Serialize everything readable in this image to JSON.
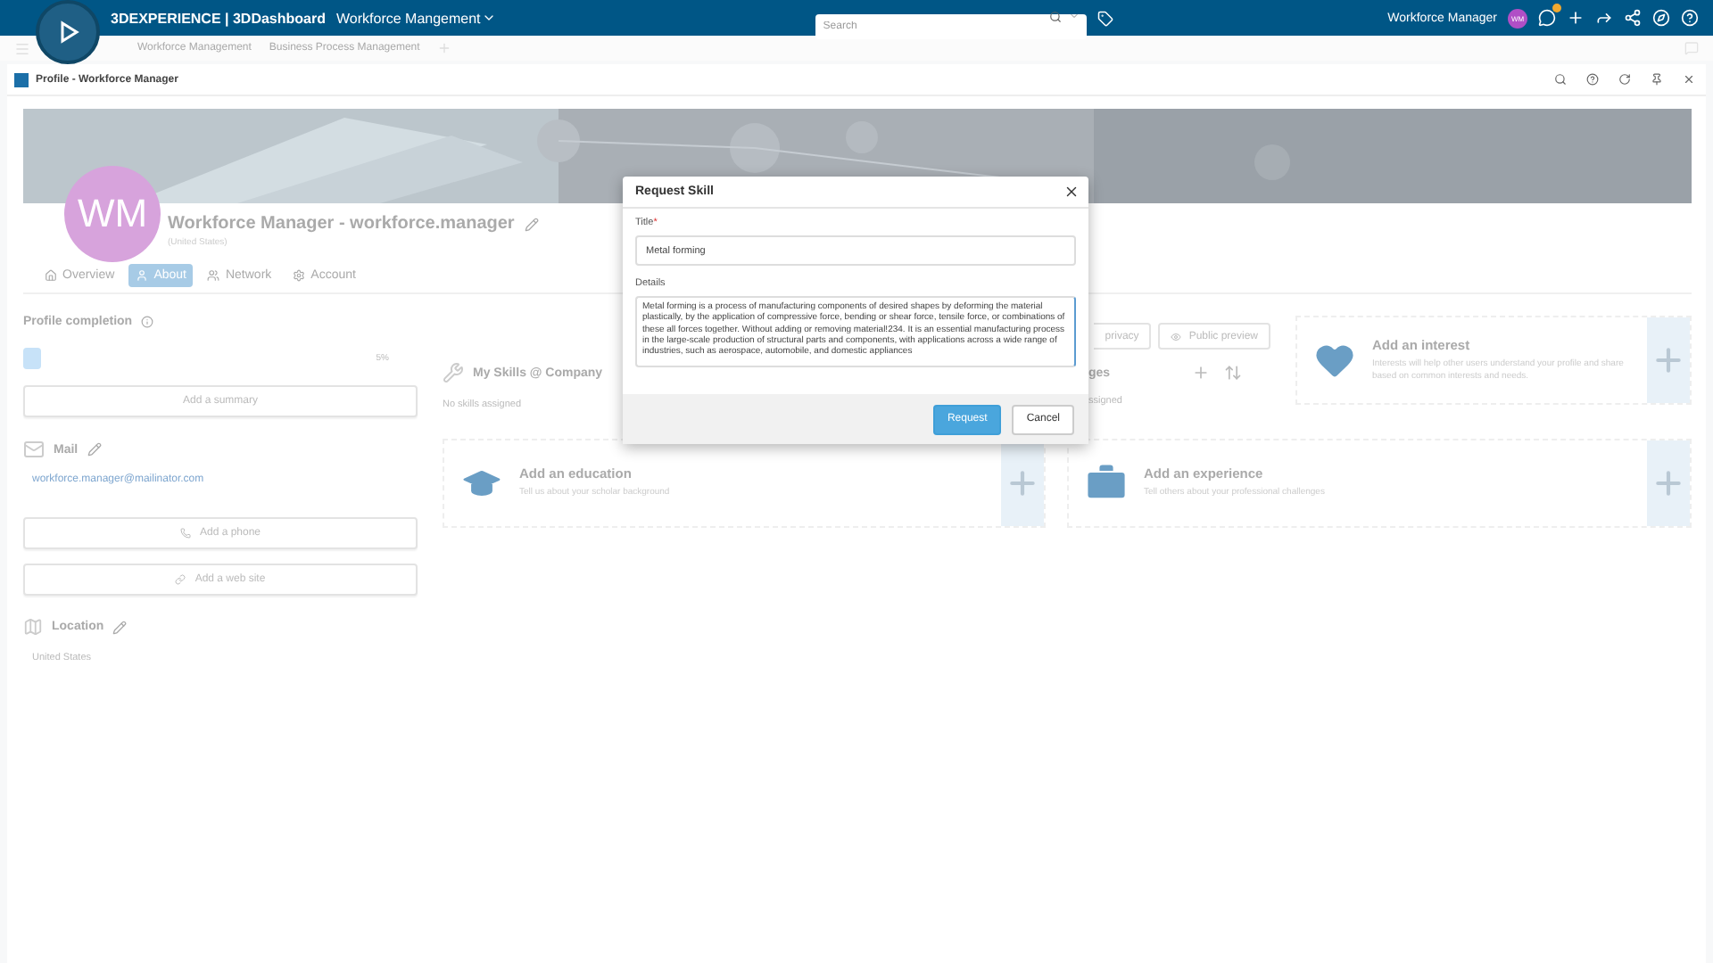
{
  "topbar": {
    "brand": "3DEXPERIENCE | 3DDashboard",
    "app": "Workforce Mangement",
    "search_placeholder": "Search",
    "user": "Workforce Manager",
    "avatar": "WM"
  },
  "dashboard_tabs": [
    "Workforce Management",
    "Business Process Management"
  ],
  "widget": {
    "title": "Profile - Workforce Manager"
  },
  "profile": {
    "initials": "WM",
    "name": "Workforce Manager - workforce.manager",
    "country": "(United States)"
  },
  "tabs": [
    {
      "label": "Overview",
      "selected": false
    },
    {
      "label": "About",
      "selected": true
    },
    {
      "label": "Network",
      "selected": false
    },
    {
      "label": "Account",
      "selected": false
    }
  ],
  "completion": {
    "title": "Profile completion",
    "level": 0.05,
    "reading": "5%"
  },
  "summary_button": "Add a summary",
  "mail": {
    "title": "Mail",
    "email": "workforce.manager@mailinator.com"
  },
  "phone_button": "Add a phone",
  "website_button": "Add a web site",
  "location": {
    "title": "Location",
    "value": "United States"
  },
  "skills": {
    "title": "My Skills @ Company",
    "empty": "No skills assigned"
  },
  "languages": {
    "title": "ges",
    "empty": "ssigned"
  },
  "preview": {
    "privacy": "privacy",
    "public": "Public preview"
  },
  "cards": [
    {
      "kind": "interest",
      "title": "Add an interest",
      "subtitle": "Interests will help other users understand your profile and share based on common interests and needs."
    },
    {
      "kind": "education",
      "title": "Add an education",
      "subtitle": "Tell us about your scholar background"
    },
    {
      "kind": "experience",
      "title": "Add an experience",
      "subtitle": "Tell others about your professional challenges"
    }
  ],
  "modal": {
    "title": "Request Skill",
    "title_label": "Title",
    "required": "*",
    "title_value": "Metal forming",
    "details_label": "Details",
    "details_value": "Metal forming is a process of manufacturing components of desired shapes by deforming the material plastically, by the application of compressive force, bending or shear force, tensile force, or combinations of these all forces together. Without adding or removing material!234. It is an essential manufacturing process in the large-scale production of structural parts and components, with applications across a wide range of industries, such as aerospace, automobile, and domestic appliances",
    "buttons": [
      {
        "kind": "primary",
        "label": "Request"
      },
      {
        "kind": "secondary",
        "label": "Cancel"
      }
    ]
  }
}
